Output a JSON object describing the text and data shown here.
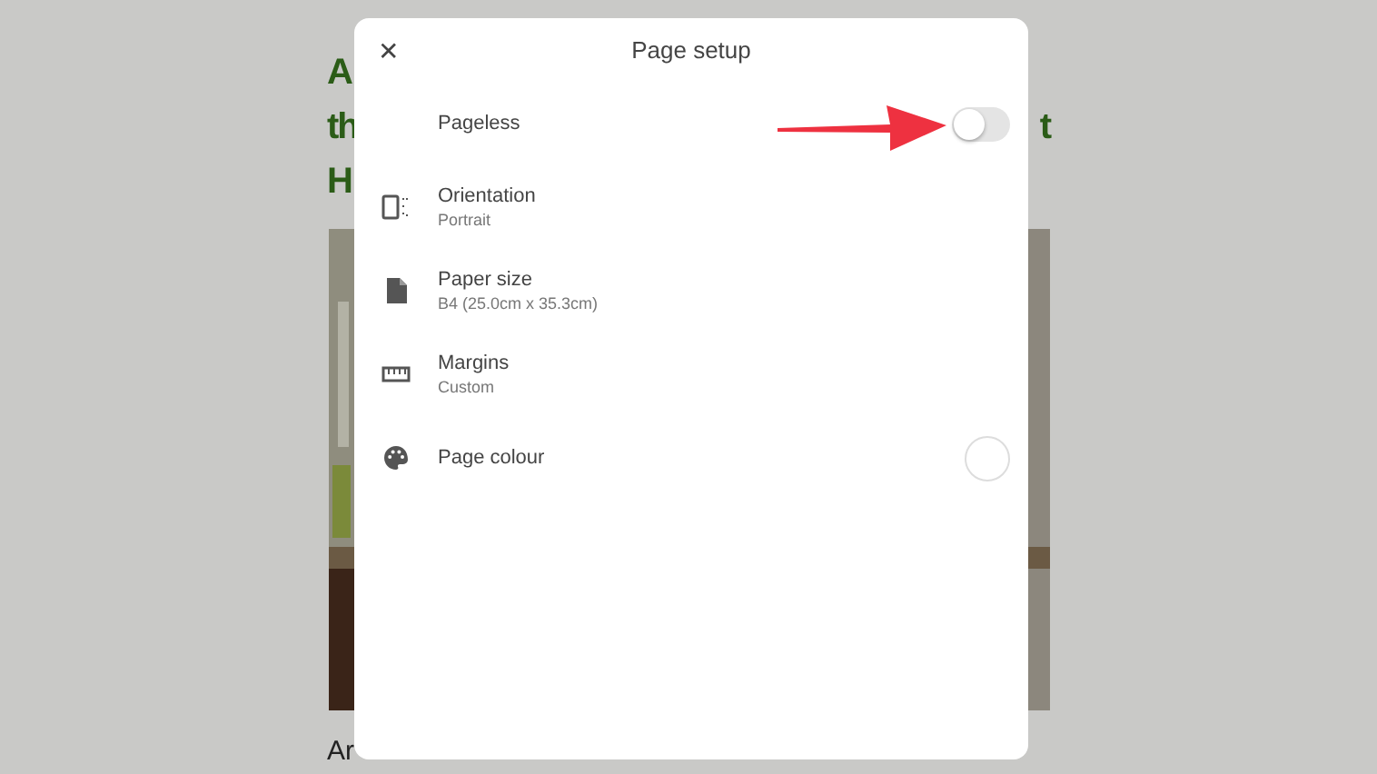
{
  "document": {
    "heading_lines": [
      {
        "left": "A"
      },
      {
        "left": "th",
        "right": "t"
      },
      {
        "left": "H"
      }
    ],
    "body_start": "Ar"
  },
  "dialog": {
    "title": "Page setup",
    "close": "✕",
    "rows": [
      {
        "kind": "toggle",
        "label": "Pageless",
        "on": false
      },
      {
        "kind": "option",
        "label": "Orientation",
        "value": "Portrait"
      },
      {
        "kind": "option",
        "label": "Paper size",
        "value": "B4 (25.0cm x 35.3cm)"
      },
      {
        "kind": "option",
        "label": "Margins",
        "value": "Custom"
      },
      {
        "kind": "swatch",
        "label": "Page colour",
        "color": "#ffffff"
      }
    ]
  }
}
